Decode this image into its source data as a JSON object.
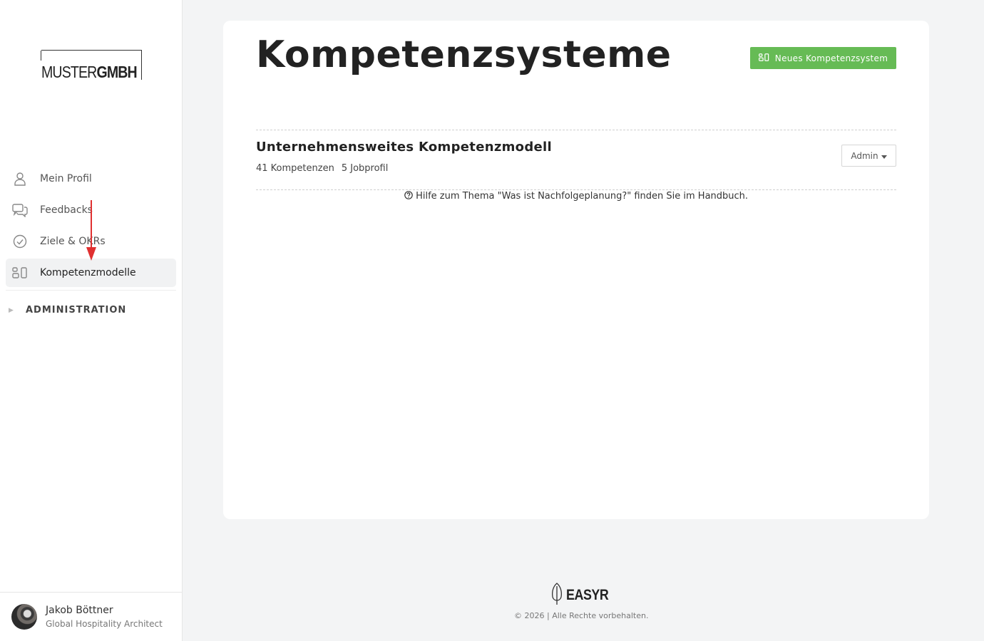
{
  "sidebar": {
    "logo": {
      "light": "MUSTER",
      "bold": "GMBH"
    },
    "items": [
      {
        "label": "Mein Profil",
        "icon": "user-icon"
      },
      {
        "label": "Feedbacks",
        "icon": "chat-bubbles-icon"
      },
      {
        "label": "Ziele & OKRs",
        "icon": "check-circle-icon"
      },
      {
        "label": "Kompetenzmodelle",
        "icon": "competency-model-icon",
        "active": true
      }
    ],
    "admin_label": "ADMINISTRATION",
    "user": {
      "name": "Jakob Böttner",
      "role": "Global Hospitality Architect"
    }
  },
  "main": {
    "title": "Kompetenzsysteme",
    "new_button_label": "Neues Kompetenzsystem",
    "system": {
      "title": "Unternehmensweites Kompetenzmodell",
      "competencies": "41 Kompetenzen",
      "jobprofiles": "5 Jobprofil",
      "admin_label": "Admin"
    },
    "help_text": "Hilfe zum Thema \"Was ist Nachfolgeplanung?\" finden Sie im Handbuch."
  },
  "footer": {
    "brand": "EASYR",
    "copyright": "© 2026 | Alle Rechte vorbehalten."
  },
  "colors": {
    "accent_green": "#66bb55",
    "annotation_red": "#e03030",
    "background": "#f3f4f5"
  }
}
